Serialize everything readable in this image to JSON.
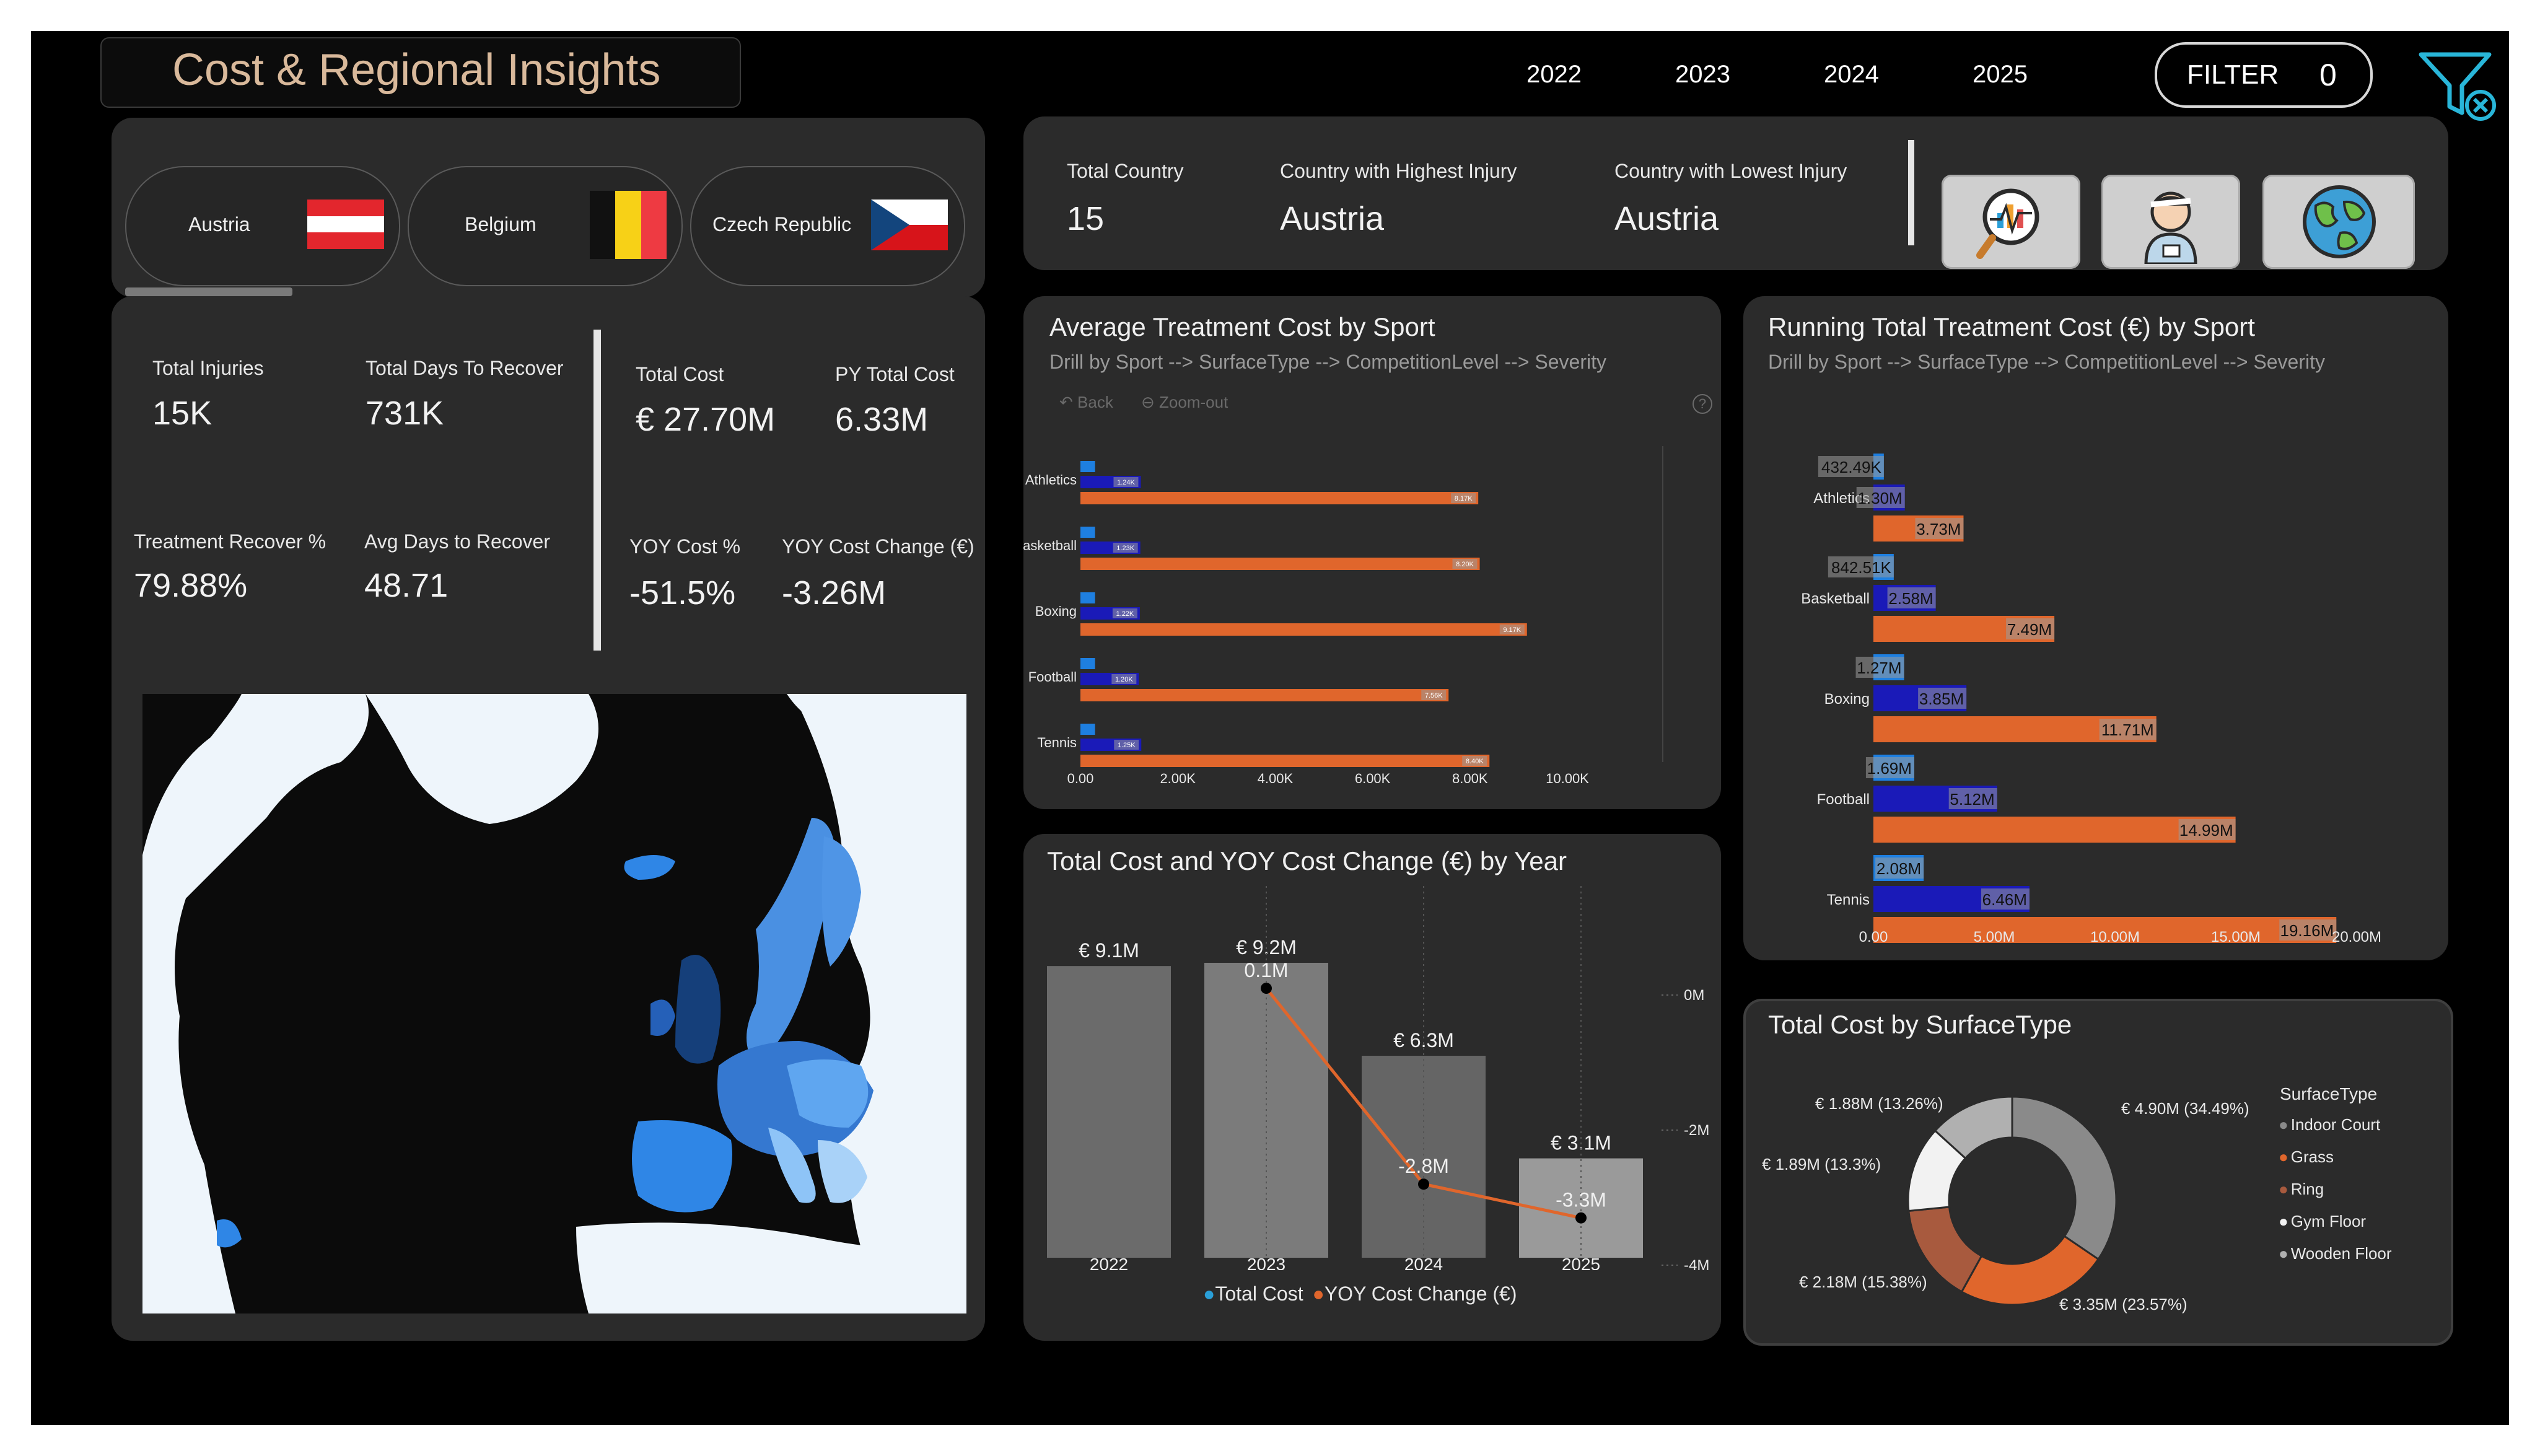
{
  "header": {
    "title": "Cost & Regional Insights",
    "years": [
      "2022",
      "2023",
      "2024",
      "2025"
    ],
    "filter_label": "FILTER",
    "filter_count": "0"
  },
  "countries": [
    {
      "name": "Austria",
      "flag": "austria-flag-icon"
    },
    {
      "name": "Belgium",
      "flag": "belgium-flag-icon"
    },
    {
      "name": "Czech Republic",
      "flag": "czech-flag-icon"
    }
  ],
  "country_kpis": {
    "total_country_label": "Total Country",
    "total_country_value": "15",
    "highest_label": "Country with Highest Injury",
    "highest_value": "Austria",
    "lowest_label": "Country with Lowest Injury",
    "lowest_value": "Austria"
  },
  "kpis": {
    "total_injuries_label": "Total Injuries",
    "total_injuries_value": "15K",
    "days_recover_label": "Total Days To Recover",
    "days_recover_value": "731K",
    "treatment_label": "Treatment Recover %",
    "treatment_value": "79.88%",
    "avg_days_label": "Avg Days to Recover",
    "avg_days_value": "48.71",
    "total_cost_label": "Total Cost",
    "total_cost_value": "€ 27.70M",
    "py_cost_label": "PY Total Cost",
    "py_cost_value": "6.33M",
    "yoy_pct_label": "YOY Cost %",
    "yoy_pct_value": "-51.5%",
    "yoy_change_label": "YOY Cost Change (€)",
    "yoy_change_value": "-3.26M"
  },
  "avg_chart": {
    "title": "Average Treatment Cost by Sport",
    "drill": "Drill by Sport --> SurfaceType --> CompetitionLevel --> Severity",
    "back_label": "Back",
    "zoom_label": "Zoom-out",
    "help_label": "?"
  },
  "running_chart": {
    "title": "Running Total Treatment Cost (€) by Sport",
    "drill": "Drill by Sport -->  SurfaceType --> CompetitionLevel  --> Severity"
  },
  "year_chart": {
    "title": "Total Cost and YOY Cost Change (€) by Year",
    "legend": [
      "Total Cost",
      "YOY Cost Change (€)"
    ]
  },
  "surface_chart": {
    "title": "Total Cost by SurfaceType",
    "legend_title": "SurfaceType"
  },
  "colors": {
    "bar_light_blue": "#1e7fe0",
    "bar_dark_blue": "#1a1ab8",
    "bar_orange": "#e0662c",
    "gray_bar": "#6e6e6e",
    "map_water": "#0b0b0b",
    "map_land": "#eef5fb"
  },
  "chart_data": [
    {
      "type": "bar",
      "orientation": "horizontal",
      "title": "Average Treatment Cost by Sport",
      "categories": [
        "Athletics",
        "Basketball",
        "Boxing",
        "Football",
        "Tennis"
      ],
      "series": [
        {
          "values": [
            300,
            300,
            300,
            300,
            300
          ],
          "labels": [
            "",
            "",
            "",
            "",
            ""
          ]
        },
        {
          "values": [
            1240,
            1230,
            1220,
            1200,
            1250
          ],
          "labels": [
            "1.24K",
            "1.23K",
            "1.22K",
            "1.20K",
            "1.25K"
          ]
        },
        {
          "values": [
            8170,
            8200,
            9170,
            7560,
            8400
          ],
          "labels": [
            "8.17K",
            "8.20K",
            "9.17K",
            "7.56K",
            "8.40K"
          ]
        }
      ],
      "xticks": [
        "0.00",
        "2.00K",
        "4.00K",
        "6.00K",
        "8.00K",
        "10.00K"
      ],
      "xlim": [
        0,
        10000
      ]
    },
    {
      "type": "bar",
      "orientation": "horizontal",
      "title": "Running Total Treatment Cost (€) by Sport",
      "categories": [
        "Athletics",
        "Basketball",
        "Boxing",
        "Football",
        "Tennis"
      ],
      "series": [
        {
          "values": [
            0.43249,
            0.84251,
            1.27,
            1.69,
            2.08
          ],
          "labels": [
            "432.49K",
            "842.51K",
            "1.27M",
            "1.69M",
            "2.08M"
          ]
        },
        {
          "values": [
            1.3,
            2.58,
            3.85,
            5.12,
            6.46
          ],
          "labels": [
            "1.30M",
            "2.58M",
            "3.85M",
            "5.12M",
            "6.46M"
          ]
        },
        {
          "values": [
            3.73,
            7.49,
            11.71,
            14.99,
            19.16
          ],
          "labels": [
            "3.73M",
            "7.49M",
            "11.71M",
            "14.99M",
            "19.16M"
          ]
        }
      ],
      "xticks": [
        "0.00",
        "5.00M",
        "10.00M",
        "15.00M",
        "20.00M"
      ],
      "xlim": [
        0,
        20
      ]
    },
    {
      "type": "bar",
      "title": "Total Cost and YOY Cost Change (€) by Year",
      "categories": [
        "2022",
        "2023",
        "2024",
        "2025"
      ],
      "series": [
        {
          "name": "Total Cost",
          "values": [
            9.1,
            9.2,
            6.3,
            3.1
          ],
          "labels": [
            "€ 9.1M",
            "€ 9.2M",
            "€ 6.3M",
            "€ 3.1M"
          ]
        },
        {
          "name": "YOY Cost Change (€)",
          "type": "line",
          "values": [
            null,
            0.1,
            -2.8,
            -3.3
          ],
          "labels": [
            "",
            "0.1M",
            "-2.8M",
            "-3.3M"
          ]
        }
      ],
      "y2_ticks": [
        "0M",
        "-2M",
        "-4M"
      ],
      "y2lim": [
        -4,
        0
      ]
    },
    {
      "type": "pie",
      "donut": true,
      "title": "Total Cost by SurfaceType",
      "categories": [
        "Indoor Court",
        "Grass",
        "Ring",
        "Gym Floor",
        "Wooden Floor"
      ],
      "values": [
        34.49,
        23.57,
        15.38,
        13.3,
        13.26
      ],
      "labels": [
        "€ 4.90M (34.49%)",
        "€ 3.35M (23.57%)",
        "€ 2.18M (15.38%)",
        "€ 1.89M (13.3%)",
        "€ 1.88M (13.26%)"
      ],
      "colors": [
        "#8a8a8a",
        "#e0662c",
        "#a85a3e",
        "#f2f2f2",
        "#b0b0b0"
      ]
    }
  ]
}
